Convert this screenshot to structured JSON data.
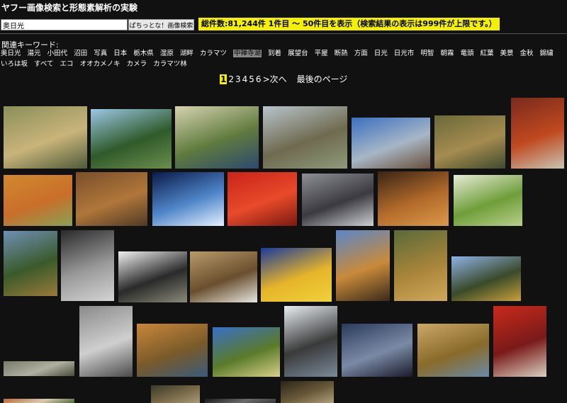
{
  "page": {
    "title": "ヤフー画像検索と形態素解析の実験"
  },
  "search": {
    "query": "奥日光",
    "button_label": "ぱちっとな！画像検索"
  },
  "results": {
    "info": "総件数:81,244件 1件目 〜 50件目を表示（検索結果の表示は999件が上限です。）"
  },
  "related": {
    "label": "関連キーワード:",
    "keywords": [
      "奥日光",
      "湯元",
      "小田代",
      "沼田",
      "写真",
      "日本",
      "栃木県",
      "湿原",
      "湖畔",
      "カラマツ",
      "中禅寺湖",
      "到着",
      "展望台",
      "平屋",
      "断熱",
      "方面",
      "日光",
      "日光市",
      "明智",
      "朝霧",
      "竜頭",
      "紅葉",
      "美景",
      "金秋",
      "錦繍",
      "いろは坂",
      "すべて",
      "エコ",
      "オオカメノキ",
      "カメラ",
      "カラマツ林"
    ],
    "active_index": 10
  },
  "pagination": {
    "pages": [
      "1",
      "2",
      "3",
      "4",
      "5",
      "6"
    ],
    "current_index": 0,
    "next_label": "次へ",
    "last_label": "最後のページ"
  },
  "thumbnails": [
    {
      "colors": [
        "#8a8f5a",
        "#c9b47a",
        "#4f5a3a"
      ]
    },
    {
      "colors": [
        "#9cc6e6",
        "#2f5a2a",
        "#6b8e4e"
      ]
    },
    {
      "colors": [
        "#d7d3b0",
        "#5f7a3e",
        "#2c4a6e"
      ]
    },
    {
      "colors": [
        "#b8c4cc",
        "#6f6a4f",
        "#8e9a7a"
      ]
    },
    {
      "colors": [
        "#3a6fc0",
        "#a7b6c6",
        "#6a4f3a"
      ]
    },
    {
      "colors": [
        "#6a6a3a",
        "#a58b4f",
        "#3f4a2f"
      ]
    },
    {
      "colors": [
        "#7a2a1e",
        "#c0491f",
        "#c9c4b4"
      ]
    },
    {
      "colors": [
        "#d1892f",
        "#c96e2a",
        "#8aa056"
      ]
    },
    {
      "colors": [
        "#7a4f2a",
        "#b0763a",
        "#4f3a24"
      ]
    },
    {
      "colors": [
        "#0b1a4a",
        "#4f86c9",
        "#e6f0ff"
      ]
    },
    {
      "colors": [
        "#c9241a",
        "#e84a2a",
        "#7a1a0f"
      ]
    },
    {
      "colors": [
        "#8f8f96",
        "#3a3a40",
        "#cfcfd6"
      ]
    },
    {
      "colors": [
        "#3a2416",
        "#b36a2a",
        "#d99a4a"
      ]
    },
    {
      "colors": [
        "#e8ecd8",
        "#6f9e3a",
        "#b9cf8a"
      ]
    },
    {
      "colors": [
        "#6f8fb6",
        "#3a5a2a",
        "#9a7a3a"
      ]
    },
    {
      "colors": [
        "#2a2a2a",
        "#9a9a9a",
        "#d4d4d4"
      ]
    },
    {
      "colors": [
        "#f0f0f0",
        "#2a2a2a",
        "#8a8a7a"
      ]
    },
    {
      "colors": [
        "#b89a6a",
        "#6a4f2f",
        "#e6e6e0"
      ]
    },
    {
      "colors": [
        "#1a3a9a",
        "#e6b42a",
        "#f0d23a"
      ]
    },
    {
      "colors": [
        "#5a86c9",
        "#c98a3a",
        "#3a2a1a"
      ]
    },
    {
      "colors": [
        "#5a6a3a",
        "#a8843a",
        "#d0a85a"
      ]
    },
    {
      "colors": [
        "#8fb2e6",
        "#3a4a2a",
        "#c9a03a"
      ]
    },
    {
      "colors": [
        "#7a7a6a",
        "#b0b0a0",
        "#4a4a3a"
      ]
    },
    {
      "colors": [
        "#8a8a8a",
        "#cfcfcf",
        "#4a4a4a"
      ]
    },
    {
      "colors": [
        "#c9873a",
        "#7a5a2a",
        "#3a5a7a"
      ]
    },
    {
      "colors": [
        "#3a6fc9",
        "#5a7a2a",
        "#d8d08a"
      ]
    },
    {
      "colors": [
        "#e8eef2",
        "#3a3a3a",
        "#7a8a9a"
      ]
    },
    {
      "colors": [
        "#2a3a5a",
        "#7a8aa6",
        "#1a1a2a"
      ]
    },
    {
      "colors": [
        "#c9a86a",
        "#8a6a2a",
        "#6a8aa6"
      ]
    },
    {
      "colors": [
        "#c92a1a",
        "#7a1a1a",
        "#d9d0c0"
      ]
    },
    {
      "colors": [
        "#b86a3a",
        "#d9c9b0",
        "#4a6a3a"
      ]
    },
    {
      "colors": [
        "#3a3a2a",
        "#7a6a4a",
        "#a89a7a"
      ]
    },
    {
      "colors": [
        "#1a1a1a",
        "#6a6a6a",
        "#3a3a3a"
      ]
    },
    {
      "colors": [
        "#2a2418",
        "#6a5a3a",
        "#b0a080"
      ]
    }
  ]
}
